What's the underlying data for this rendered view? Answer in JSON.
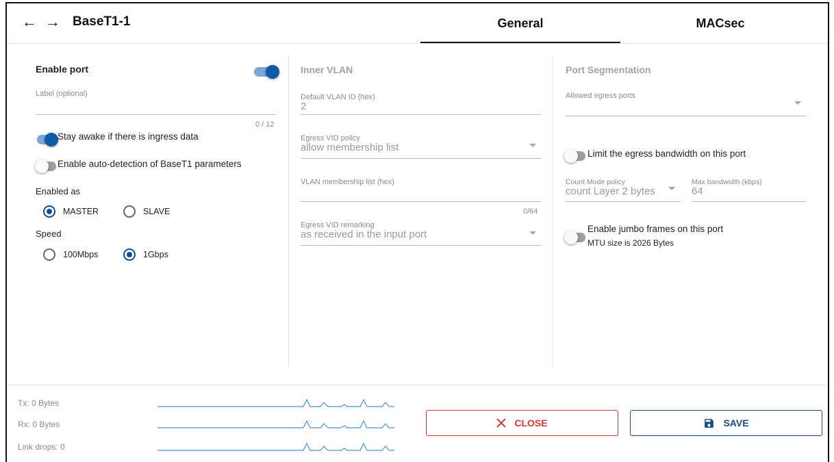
{
  "header": {
    "back_icon": "←",
    "forward_icon": "→",
    "title": "BaseT1-1",
    "tabs": [
      {
        "label": "General",
        "active": true
      },
      {
        "label": "MACsec",
        "active": false
      }
    ]
  },
  "port": {
    "enable_label": "Enable port",
    "enabled": true,
    "label_field": {
      "label": "Label (optional)",
      "value": "",
      "counter": "0 / 12"
    },
    "stay_awake": {
      "label": "Stay awake if there is ingress data",
      "on": true
    },
    "auto_detect": {
      "label": "Enable auto-detection of BaseT1 parameters",
      "on": false
    },
    "enabled_as": {
      "label": "Enabled as",
      "options": [
        "MASTER",
        "SLAVE"
      ],
      "selected": "MASTER"
    },
    "speed": {
      "label": "Speed",
      "options": [
        "100Mbps",
        "1Gbps"
      ],
      "selected": "1Gbps"
    }
  },
  "inner_vlan": {
    "title": "Inner VLAN",
    "default_vlan": {
      "label": "Default VLAN ID (hex)",
      "value": "2"
    },
    "egress_vid_policy": {
      "label": "Egress VID policy",
      "value": "allow membership list"
    },
    "membership_list": {
      "label": "VLAN membership list (hex)",
      "value": "",
      "counter": "0/64"
    },
    "egress_vid_remarking": {
      "label": "Egress VID remarking",
      "value": "as received in the input port"
    }
  },
  "segmentation": {
    "title": "Port Segmentation",
    "allowed_egress": {
      "label": "Allowed egress ports",
      "value": ""
    },
    "limit_bandwidth": {
      "label": "Limit the egress bandwidth on this port",
      "on": false
    },
    "count_mode": {
      "label": "Count Mode policy",
      "value": "count Layer 2 bytes"
    },
    "max_bandwidth": {
      "label": "Max bandwidth (kbps)",
      "value": "64"
    },
    "jumbo": {
      "label": "Enable jumbo frames on this port",
      "sublabel": "MTU size is 2026 Bytes",
      "on": false
    }
  },
  "stats": {
    "tx": "Tx: 0 Bytes",
    "rx": "Rx: 0 Bytes",
    "link_drops": "Link drops: 0"
  },
  "actions": {
    "close_label": "CLOSE",
    "save_label": "SAVE"
  },
  "colors": {
    "accent": "#0d5aa7",
    "close": "#d93838",
    "save": "#174a86",
    "sparkline": "#4a90d9"
  }
}
